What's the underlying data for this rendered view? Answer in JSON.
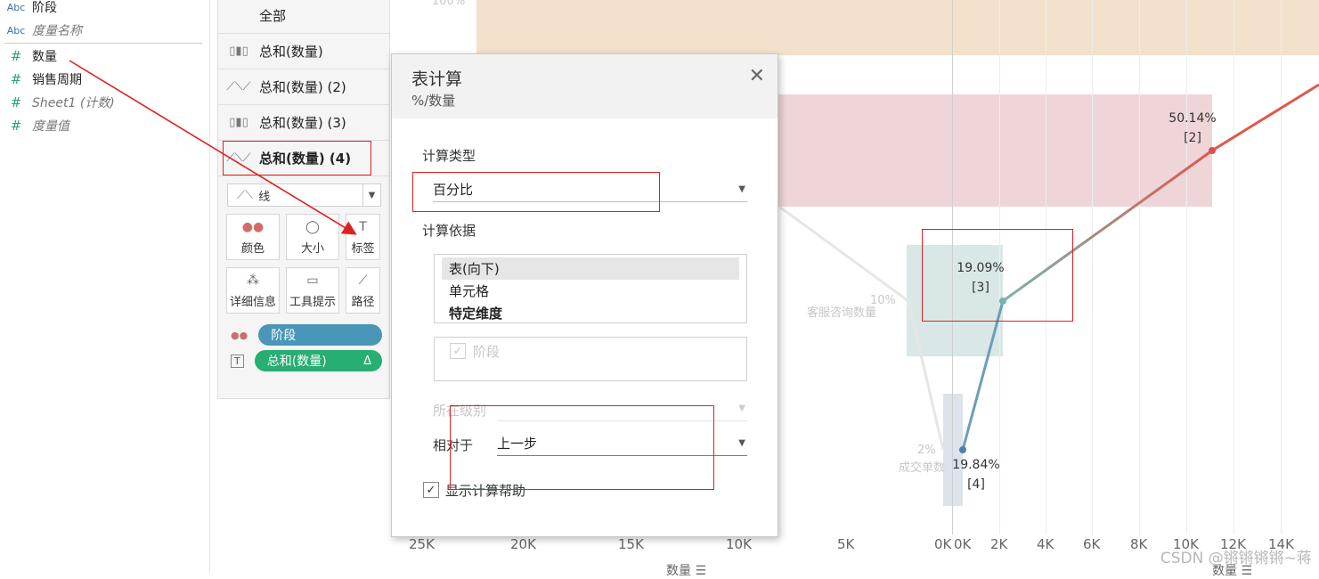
{
  "data_pane": {
    "fields": [
      {
        "icon": "Abc",
        "name": "阶段",
        "italic": false
      },
      {
        "icon": "Abc",
        "name": "度量名称",
        "italic": true
      },
      {
        "icon": "#",
        "name": "数量",
        "italic": false
      },
      {
        "icon": "#",
        "name": "销售周期",
        "italic": false
      },
      {
        "icon": "#",
        "name": "Sheet1 (计数)",
        "italic": true
      },
      {
        "icon": "#",
        "name": "度量值",
        "italic": true
      }
    ]
  },
  "marks": {
    "tabs": [
      {
        "label": "全部"
      },
      {
        "label": "总和(数量)"
      },
      {
        "label": "总和(数量) (2)"
      },
      {
        "label": "总和(数量) (3)"
      },
      {
        "label": "总和(数量) (4)"
      }
    ],
    "mark_type": "线",
    "cards": [
      "颜色",
      "大小",
      "标签",
      "详细信息",
      "工具提示",
      "路径"
    ],
    "pills": [
      {
        "label": "阶段",
        "color": "#4a96b8"
      },
      {
        "label": "总和(数量)",
        "color": "#27ae72",
        "badge": "Δ"
      }
    ]
  },
  "chart": {
    "x_ticks_left": [
      "25K",
      "20K",
      "15K",
      "10K",
      "5K",
      "0K"
    ],
    "x_ticks_right": [
      "0K",
      "2K",
      "4K",
      "6K",
      "8K",
      "10K",
      "12K",
      "14K"
    ],
    "axis_title": "数量",
    "labels": [
      {
        "pct": "50.14%",
        "idx": "[2]"
      },
      {
        "pct": "19.09%",
        "idx": "[3]"
      },
      {
        "pct": "19.84%",
        "idx": "[4]"
      }
    ],
    "faded": [
      "100%",
      "10%",
      "客服咨询数量",
      "2%",
      "成交单数"
    ],
    "colors": {
      "top_band": "#f3e1cc",
      "band2": "#efd5d7",
      "band3": "#d9e8e7",
      "band4": "#dce3ea",
      "line_red": "#e0584a",
      "line_teal": "#78b3ae",
      "line_blue": "#4e7fb0"
    }
  },
  "dialog": {
    "title": "表计算",
    "subtitle": "%/数量",
    "calc_type_label": "计算类型",
    "calc_type_value": "百分比",
    "compute_using_label": "计算依据",
    "compute_using_options": [
      {
        "label": "表(向下)",
        "selected": true,
        "bold": false
      },
      {
        "label": "单元格",
        "selected": false,
        "bold": false
      },
      {
        "label": "特定维度",
        "selected": false,
        "bold": true
      }
    ],
    "dimension_checkbox": "阶段",
    "level_label": "所在级别",
    "relative_to_label": "相对于",
    "relative_to_value": "上一步",
    "show_help_label": "显示计算帮助"
  },
  "watermark": "CSDN @锵锵锵锵~蒋"
}
